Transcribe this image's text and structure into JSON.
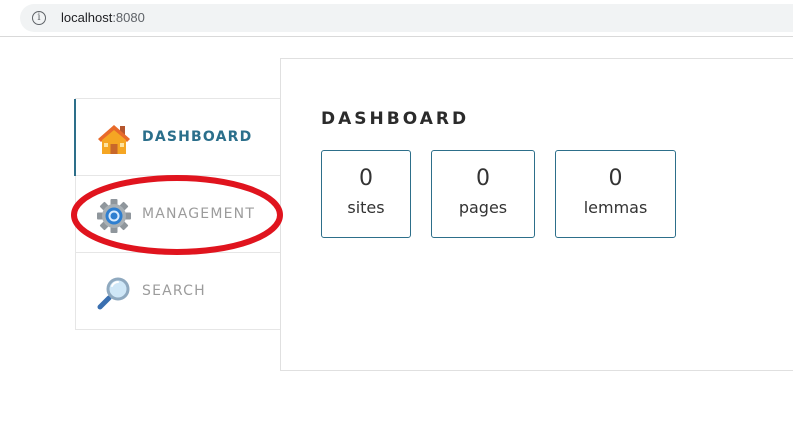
{
  "browser": {
    "url_host": "localhost",
    "url_port": ":8080",
    "info_icon_glyph": "i"
  },
  "sidebar": {
    "items": [
      {
        "label": "DASHBOARD",
        "icon": "home-icon",
        "active": true
      },
      {
        "label": "MANAGEMENT",
        "icon": "gear-icon",
        "active": false
      },
      {
        "label": "SEARCH",
        "icon": "magnifier-icon",
        "active": false
      }
    ]
  },
  "main": {
    "title": "DASHBOARD",
    "stats": [
      {
        "value": "0",
        "label": "sites"
      },
      {
        "value": "0",
        "label": "pages"
      },
      {
        "value": "0",
        "label": "lemmas"
      }
    ]
  },
  "colors": {
    "accent": "#2b6f8b",
    "annotation": "#e0141e",
    "muted_text": "#9c9c9c"
  }
}
